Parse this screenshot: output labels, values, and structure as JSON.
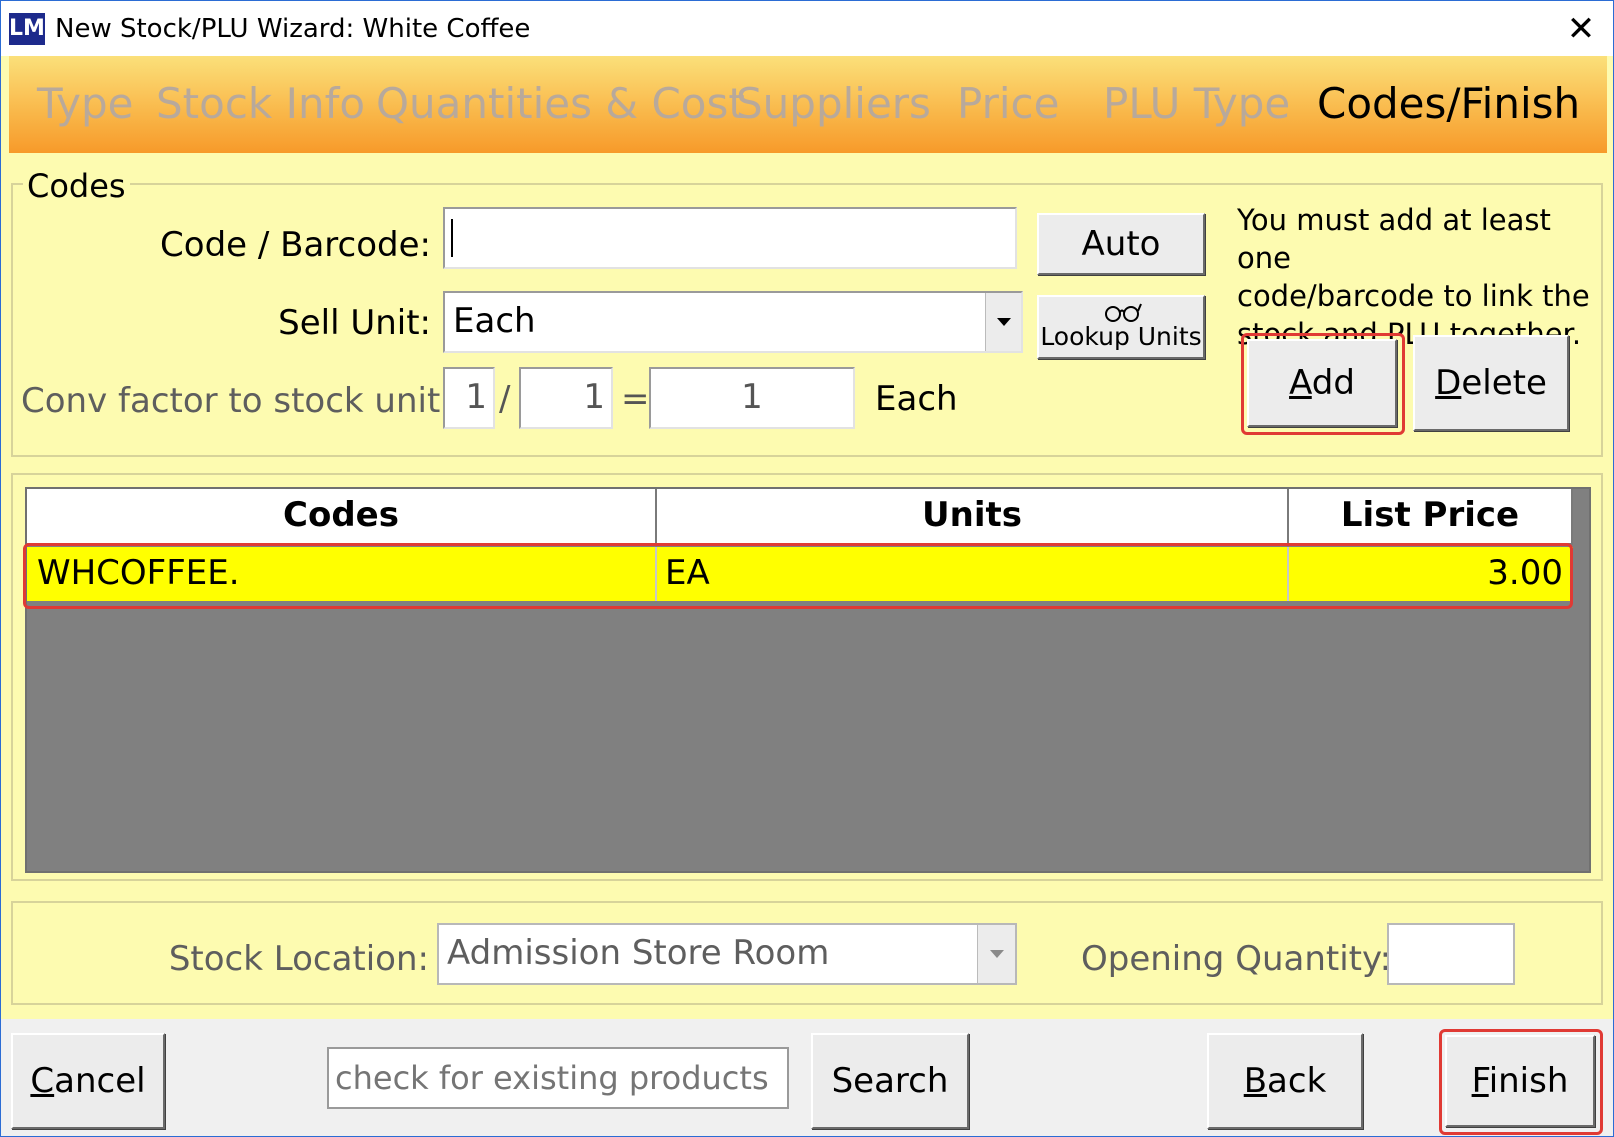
{
  "window": {
    "icon_label": "LM",
    "title": "New Stock/PLU Wizard: White Coffee",
    "close_glyph": "✕"
  },
  "steps": [
    "Type",
    "Stock Info",
    "Quantities & Cost",
    "Suppliers",
    "Price",
    "PLU Type",
    "Codes/Finish"
  ],
  "active_step": "Codes/Finish",
  "codes_group": {
    "title": "Codes",
    "code_label": "Code / Barcode:",
    "code_value": "",
    "auto_button": "Auto",
    "sell_unit_label": "Sell Unit:",
    "sell_unit_value": "Each",
    "lookup_units_button": "Lookup Units",
    "conv_label": "Conv factor to stock unit:",
    "conv_numerator": "1",
    "conv_denominator": "1",
    "conv_slash": "/",
    "conv_equals": "=",
    "conv_result": "1",
    "conv_unit": "Each",
    "note": [
      "You must add at least one",
      "code/barcode to link the",
      "stock and PLU together."
    ],
    "add_button": {
      "accel": "A",
      "rest": "dd"
    },
    "delete_button": {
      "accel": "D",
      "rest": "elete"
    }
  },
  "codes_table": {
    "columns": [
      "Codes",
      "Units",
      "List Price"
    ],
    "rows": [
      {
        "code": "WHCOFFEE.",
        "units": "EA",
        "list_price": "3.00"
      }
    ]
  },
  "location": {
    "stock_location_label": "Stock Location:",
    "stock_location_value": "Admission Store Room",
    "opening_quantity_label": "Opening Quantity:",
    "opening_quantity_value": ""
  },
  "footer": {
    "cancel_button": {
      "accel": "C",
      "rest": "ancel"
    },
    "search_placeholder": "check for existing products",
    "search_button": "Search",
    "back_button": {
      "accel": "B",
      "rest": "ack"
    },
    "finish_button": {
      "accel": "F",
      "rest": "inish"
    }
  },
  "colors": {
    "background": "#fdfbb0",
    "selected_row": "#ffff00",
    "highlight_border": "#e03a34",
    "header_gradient_top": "#fbe07a",
    "header_gradient_bottom": "#f79a2a"
  }
}
